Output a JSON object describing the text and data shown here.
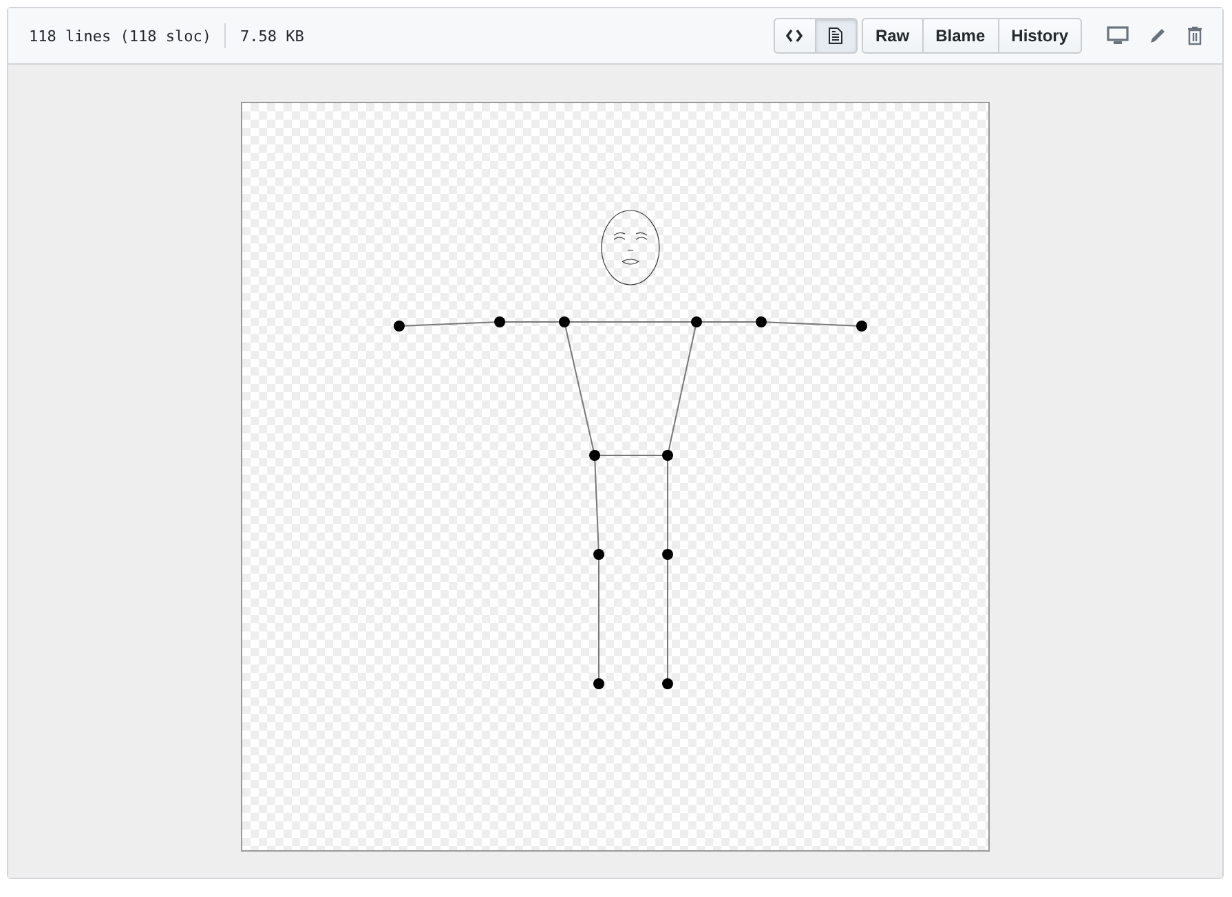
{
  "file_info": {
    "lines": "118 lines (118 sloc)",
    "size": "7.58 KB"
  },
  "view_toggle": [
    {
      "kind": "source",
      "selected": false
    },
    {
      "kind": "rendered",
      "selected": true
    }
  ],
  "buttons": [
    "Raw",
    "Blame",
    "History"
  ]
}
